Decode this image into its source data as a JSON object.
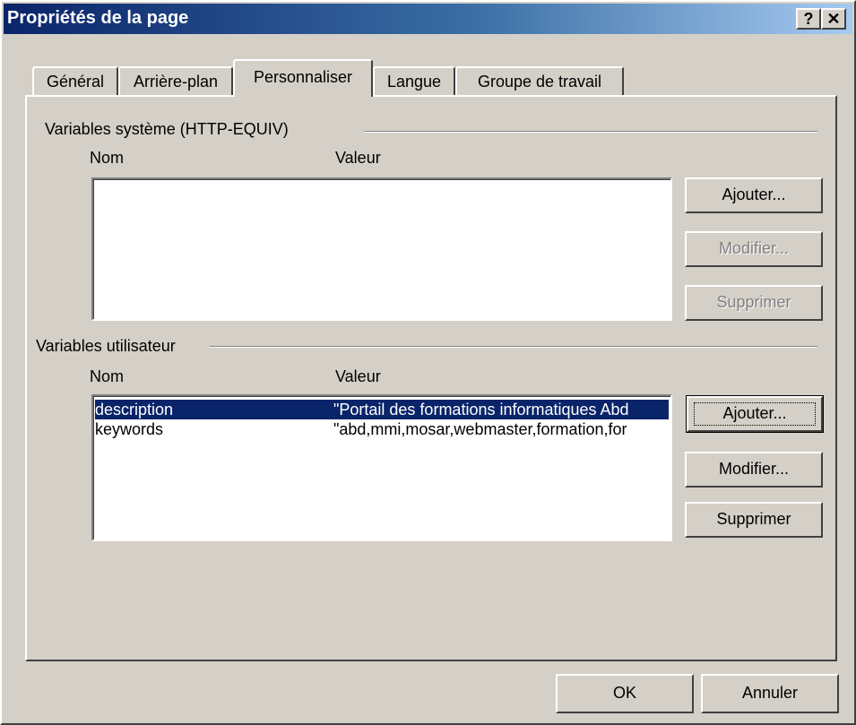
{
  "window": {
    "title": "Propriétés de la page",
    "help_button": "?",
    "close_button": "✕"
  },
  "tabs": [
    {
      "label": "Général"
    },
    {
      "label": "Arrière-plan"
    },
    {
      "label": "Personnaliser",
      "active": true
    },
    {
      "label": "Langue"
    },
    {
      "label": "Groupe de travail"
    }
  ],
  "system_vars": {
    "group_label": "Variables système (HTTP-EQUIV)",
    "col_name": "Nom",
    "col_value": "Valeur",
    "rows": [],
    "add_label": "Ajouter...",
    "modify_label": "Modifier...",
    "delete_label": "Supprimer"
  },
  "user_vars": {
    "group_label": "Variables utilisateur",
    "col_name": "Nom",
    "col_value": "Valeur",
    "rows": [
      {
        "name": "description",
        "value": "\"Portail des formations informatiques Abd",
        "selected": true
      },
      {
        "name": "keywords",
        "value": "\"abd,mmi,mosar,webmaster,formation,for",
        "selected": false
      }
    ],
    "add_label": "Ajouter...",
    "modify_label": "Modifier...",
    "delete_label": "Supprimer"
  },
  "footer": {
    "ok_label": "OK",
    "cancel_label": "Annuler"
  }
}
